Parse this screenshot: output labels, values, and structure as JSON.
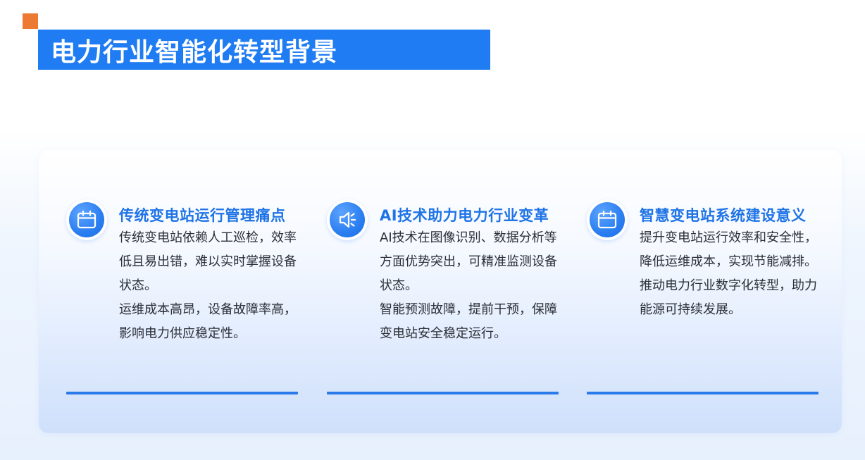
{
  "header": {
    "title": "电力行业智能化转型背景"
  },
  "colors": {
    "accent": "#ec7a32",
    "brand_blue": "#1f7cf2",
    "title_blue": "#1e73e6"
  },
  "cards": [
    {
      "icon": "calendar-icon",
      "title": "传统变电站运行管理痛点",
      "paragraphs": [
        "传统变电站依赖人工巡检，效率低且易出错，难以实时掌握设备状态。",
        "运维成本高昂，设备故障率高，影响电力供应稳定性。"
      ]
    },
    {
      "icon": "speaker-icon",
      "title": "AI技术助力电力行业变革",
      "paragraphs": [
        "AI技术在图像识别、数据分析等方面优势突出，可精准监测设备状态。",
        "智能预测故障，提前干预，保障变电站安全稳定运行。"
      ]
    },
    {
      "icon": "calendar-icon",
      "title": "智慧变电站系统建设意义",
      "paragraphs": [
        "提升变电站运行效率和安全性，降低运维成本，实现节能减排。推动电力行业数字化转型，助力能源可持续发展。"
      ]
    }
  ]
}
